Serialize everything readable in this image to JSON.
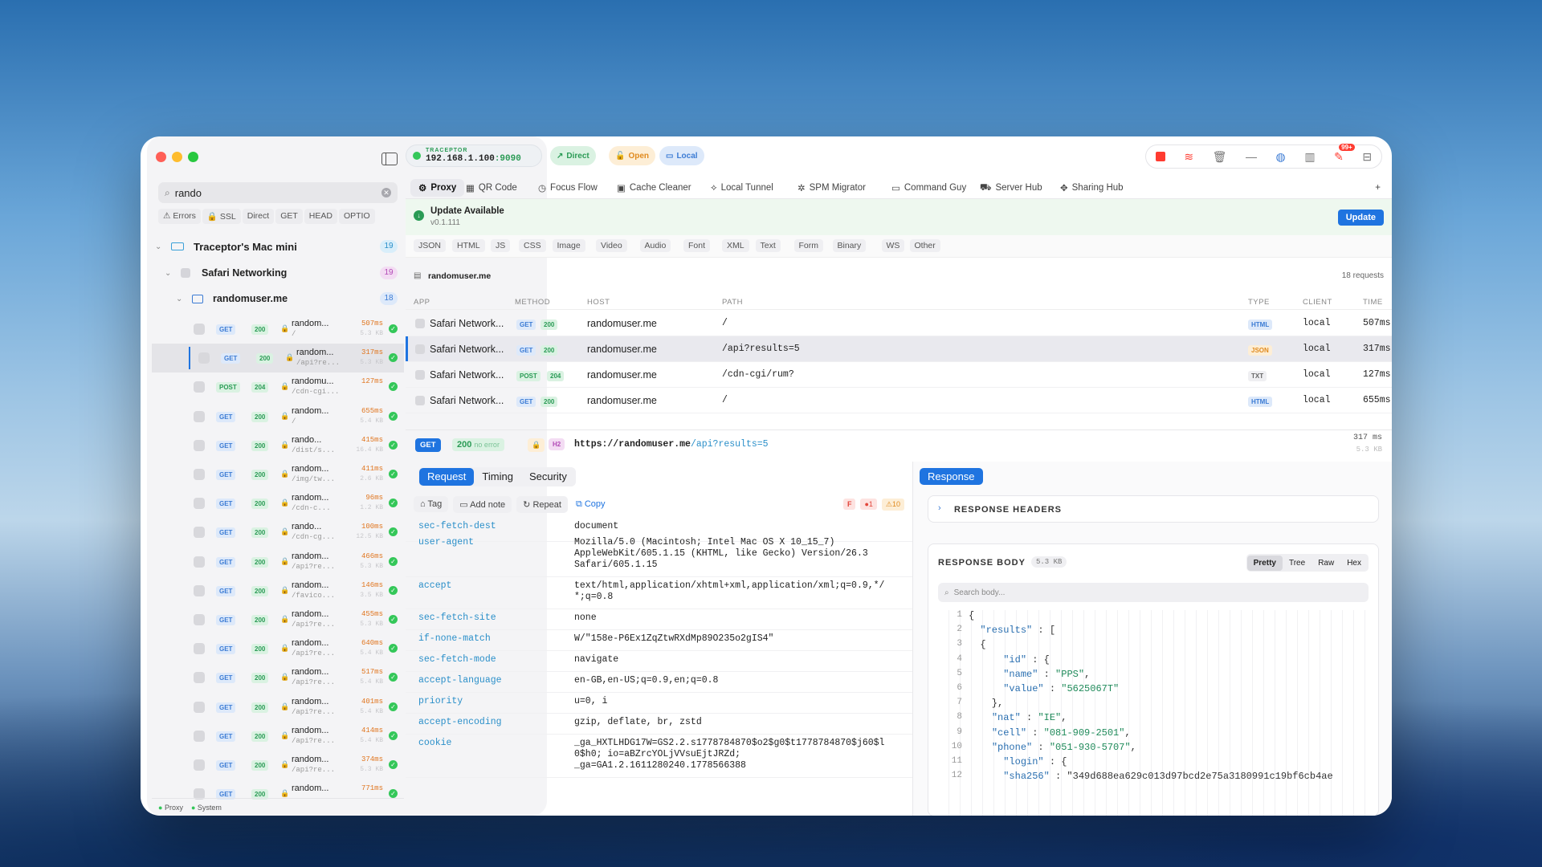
{
  "window": {
    "app_name": "TRACEPTOR",
    "ip": "192.168.1.100",
    "port": ":9090"
  },
  "modes": {
    "direct": "Direct",
    "open": "Open",
    "local": "Local"
  },
  "toolbar_badge": "99+",
  "sidebar": {
    "search_value": "rando",
    "filters": [
      "⚠ Errors",
      "🔒 SSL",
      "Direct",
      "GET",
      "HEAD",
      "OPTIO"
    ],
    "device": {
      "name": "Traceptor's Mac mini",
      "count": "19"
    },
    "app": {
      "name": "Safari Networking",
      "count": "19"
    },
    "host": {
      "name": "randomuser.me",
      "count": "18"
    },
    "requests": [
      {
        "method": "GET",
        "status": "200",
        "host": "random...",
        "path": "/",
        "time": "507ms",
        "size": "5.3 KB"
      },
      {
        "method": "GET",
        "status": "200",
        "host": "random...",
        "path": "/api?re...",
        "time": "317ms",
        "size": "5.3 KB",
        "selected": true
      },
      {
        "method": "POST",
        "status": "204",
        "host": "randomu...",
        "path": "/cdn-cgi...",
        "time": "127ms",
        "size": ""
      },
      {
        "method": "GET",
        "status": "200",
        "host": "random...",
        "path": "/",
        "time": "655ms",
        "size": "5.4 KB"
      },
      {
        "method": "GET",
        "status": "200",
        "host": "rando...",
        "path": "/dist/s...",
        "time": "415ms",
        "size": "16.4 KB"
      },
      {
        "method": "GET",
        "status": "200",
        "host": "random...",
        "path": "/img/tw...",
        "time": "411ms",
        "size": "2.6 KB"
      },
      {
        "method": "GET",
        "status": "200",
        "host": "random...",
        "path": "/cdn-c...",
        "time": "96ms",
        "size": "1.2 KB"
      },
      {
        "method": "GET",
        "status": "200",
        "host": "rando...",
        "path": "/cdn-cg...",
        "time": "100ms",
        "size": "12.5 KB"
      },
      {
        "method": "GET",
        "status": "200",
        "host": "random...",
        "path": "/api?re...",
        "time": "466ms",
        "size": "5.3 KB"
      },
      {
        "method": "GET",
        "status": "200",
        "host": "random...",
        "path": "/favico...",
        "time": "146ms",
        "size": "3.5 KB"
      },
      {
        "method": "GET",
        "status": "200",
        "host": "random...",
        "path": "/api?re...",
        "time": "455ms",
        "size": "5.3 KB"
      },
      {
        "method": "GET",
        "status": "200",
        "host": "random...",
        "path": "/api?re...",
        "time": "640ms",
        "size": "5.4 KB"
      },
      {
        "method": "GET",
        "status": "200",
        "host": "random...",
        "path": "/api?re...",
        "time": "517ms",
        "size": "5.4 KB"
      },
      {
        "method": "GET",
        "status": "200",
        "host": "random...",
        "path": "/api?re...",
        "time": "401ms",
        "size": "5.4 KB"
      },
      {
        "method": "GET",
        "status": "200",
        "host": "random...",
        "path": "/api?re...",
        "time": "414ms",
        "size": "5.4 KB"
      },
      {
        "method": "GET",
        "status": "200",
        "host": "random...",
        "path": "/api?re...",
        "time": "374ms",
        "size": "5.3 KB"
      },
      {
        "method": "GET",
        "status": "200",
        "host": "random...",
        "path": "",
        "time": "771ms",
        "size": ""
      }
    ],
    "footer": {
      "proxy": "Proxy",
      "system": "System"
    }
  },
  "tabs": [
    "Proxy",
    "QR Code",
    "Focus Flow",
    "Cache Cleaner",
    "Local Tunnel",
    "SPM Migrator",
    "Command Guy",
    "Server Hub",
    "Sharing Hub"
  ],
  "tab_icons": [
    "⚙",
    "▦",
    "◷",
    "▣",
    "⟡",
    "✲",
    "▭",
    "⛟",
    "✥"
  ],
  "update": {
    "title": "Update Available",
    "version": "v0.1.111",
    "button": "Update"
  },
  "type_filters": [
    "JSON",
    "HTML",
    "JS",
    "CSS",
    "Image",
    "Video",
    "Audio",
    "Font",
    "XML",
    "Text",
    "Form",
    "Binary",
    "WS",
    "Other"
  ],
  "list_header": {
    "host": "randomuser.me",
    "count": "18 requests"
  },
  "columns": {
    "app": "APP",
    "method": "METHOD",
    "host": "HOST",
    "path": "PATH",
    "type": "TYPE",
    "client": "CLIENT",
    "time": "TIME"
  },
  "rows": [
    {
      "app": "Safari Network...",
      "method": "GET",
      "status": "200",
      "host": "randomuser.me",
      "path": "/",
      "type": "HTML",
      "client": "local",
      "time": "507ms"
    },
    {
      "app": "Safari Network...",
      "method": "GET",
      "status": "200",
      "host": "randomuser.me",
      "path": "/api?results=5",
      "type": "JSON",
      "client": "local",
      "time": "317ms"
    },
    {
      "app": "Safari Network...",
      "method": "POST",
      "status": "204",
      "host": "randomuser.me",
      "path": "/cdn-cgi/rum?",
      "type": "TXT",
      "client": "local",
      "time": "127ms"
    },
    {
      "app": "Safari Network...",
      "method": "GET",
      "status": "200",
      "host": "randomuser.me",
      "path": "/",
      "type": "HTML",
      "client": "local",
      "time": "655ms"
    }
  ],
  "detail": {
    "method": "GET",
    "status": "200",
    "status_text": "no error",
    "proto": "H2",
    "url_base": "https://randomuser.me",
    "url_path": "/api?results=5",
    "time": "317 ms",
    "size": "5.3 KB",
    "req_tabs": [
      "Request",
      "Timing",
      "Security"
    ],
    "actions": {
      "tag": "Tag",
      "note": "Add note",
      "repeat": "Repeat",
      "copy": "Copy"
    },
    "flags": {
      "f": "F",
      "err": "1",
      "warn": "10"
    },
    "headers": [
      {
        "k": "sec-fetch-dest",
        "v": "document"
      },
      {
        "k": "user-agent",
        "v": "Mozilla/5.0 (Macintosh; Intel Mac OS X 10_15_7)\nAppleWebKit/605.1.15 (KHTML, like Gecko) Version/26.3\nSafari/605.1.15"
      },
      {
        "k": "accept",
        "v": "text/html,application/xhtml+xml,application/xml;q=0.9,*/\n*;q=0.8"
      },
      {
        "k": "sec-fetch-site",
        "v": "none"
      },
      {
        "k": "if-none-match",
        "v": "W/\"158e-P6Ex1ZqZtwRXdMp89O235o2gIS4\""
      },
      {
        "k": "sec-fetch-mode",
        "v": "navigate"
      },
      {
        "k": "accept-language",
        "v": "en-GB,en-US;q=0.9,en;q=0.8"
      },
      {
        "k": "priority",
        "v": "u=0, i"
      },
      {
        "k": "accept-encoding",
        "v": "gzip, deflate, br, zstd"
      },
      {
        "k": "cookie",
        "v": "_ga_HXTLHDG17W=GS2.2.s1778784870$o2$g0$t1778784870$j60$l\n0$h0; io=aBZrcYOLjVVsuEjtJRZd;\n_ga=GA1.2.1611280240.1778566388"
      }
    ]
  },
  "response": {
    "tab": "Response",
    "headers_title": "RESPONSE HEADERS",
    "body_title": "RESPONSE BODY",
    "body_size": "5.3 KB",
    "views": [
      "Pretty",
      "Tree",
      "Raw",
      "Hex"
    ],
    "search_placeholder": "Search body...",
    "lines": [
      "{",
      "  \"results\" : [",
      "  {",
      "      \"id\" : {",
      "      \"name\" : \"PPS\",",
      "      \"value\" : \"5625067T\"",
      "    },",
      "    \"nat\" : \"IE\",",
      "    \"cell\" : \"081-909-2501\",",
      "    \"phone\" : \"051-930-5707\",",
      "      \"login\" : {",
      "      \"sha256\" : \"349d688ea629c013d97bcd2e75a3180991c19bf6cb4ae"
    ]
  }
}
